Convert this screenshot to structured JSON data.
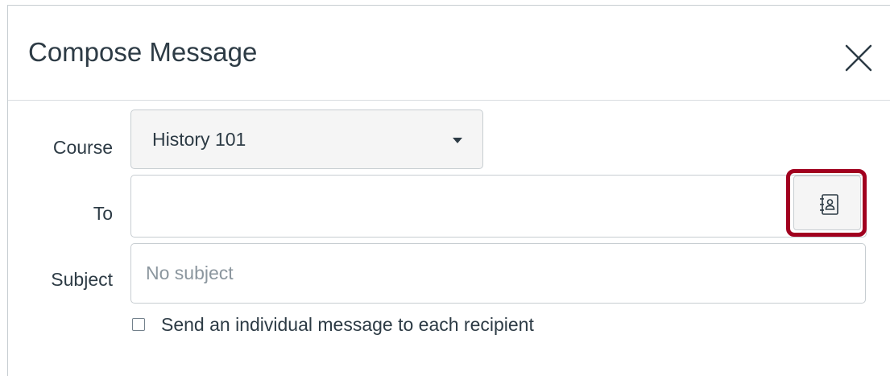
{
  "dialog": {
    "title": "Compose Message",
    "close_icon": "close-icon"
  },
  "form": {
    "course": {
      "label": "Course",
      "selected": "History 101"
    },
    "to": {
      "label": "To",
      "value": "",
      "address_book_icon": "address-book-icon"
    },
    "subject": {
      "label": "Subject",
      "placeholder": "No subject",
      "value": ""
    },
    "individual_message": {
      "label": "Send an individual message to each recipient",
      "checked": false
    }
  },
  "colors": {
    "highlight": "#a1001f",
    "text": "#2d3b45",
    "border": "#c7cdd1"
  }
}
